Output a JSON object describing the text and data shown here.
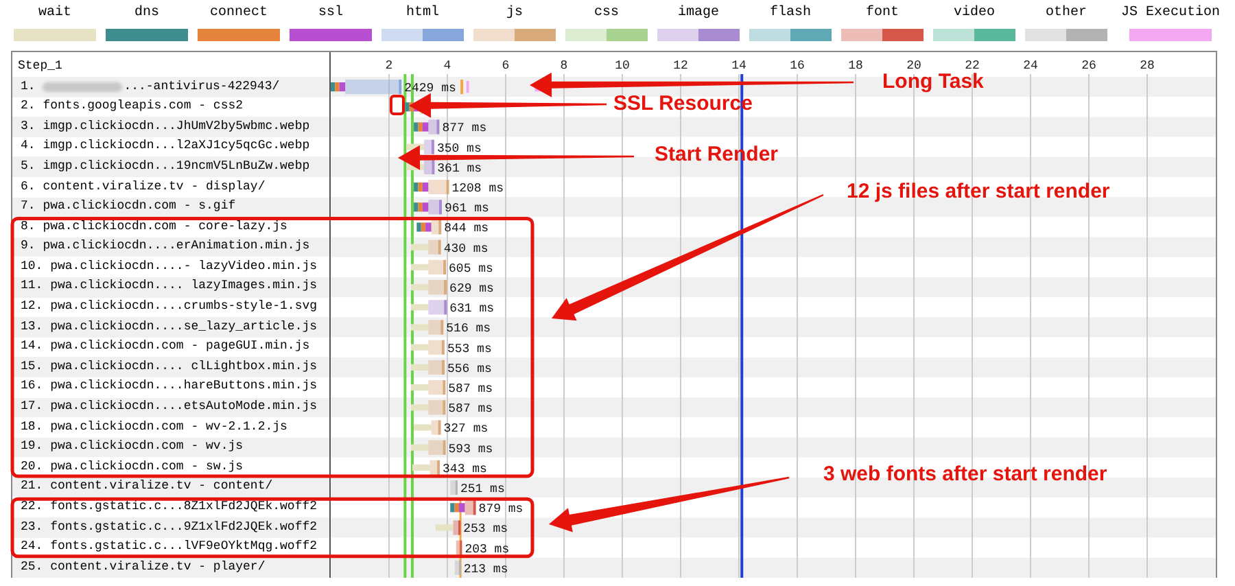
{
  "legend": [
    {
      "label": "wait",
      "kind": "phase",
      "color": "#e6e3c4"
    },
    {
      "label": "dns",
      "kind": "phase",
      "color": "#3f8c8f"
    },
    {
      "label": "connect",
      "kind": "phase",
      "color": "#e5843c"
    },
    {
      "label": "ssl",
      "kind": "phase",
      "color": "#b84fd1"
    },
    {
      "label": "html",
      "kind": "type",
      "color": "#86a6dc"
    },
    {
      "label": "js",
      "kind": "type",
      "color": "#d9ab7c"
    },
    {
      "label": "css",
      "kind": "type",
      "color": "#a7d28f"
    },
    {
      "label": "image",
      "kind": "type",
      "color": "#a98bd1"
    },
    {
      "label": "flash",
      "kind": "type",
      "color": "#5ea9b3"
    },
    {
      "label": "font",
      "kind": "type",
      "color": "#d5584b"
    },
    {
      "label": "video",
      "kind": "type",
      "color": "#5ab99d"
    },
    {
      "label": "other",
      "kind": "type",
      "color": "#b3b3b3"
    },
    {
      "label": "JS Execution",
      "kind": "phase",
      "color": "#f2a9f2"
    }
  ],
  "waterfall": {
    "step_label": "Step_1",
    "ticks": [
      "2",
      "4",
      "6",
      "8",
      "10",
      "12",
      "14",
      "16",
      "18",
      "20",
      "22",
      "24",
      "26",
      "28"
    ],
    "rows": [
      {
        "label": "1. ...-antivirus-422943/",
        "duration": "2429 ms",
        "kind": "html",
        "redacted": true,
        "new_connection": true,
        "queued": false
      },
      {
        "label": "2. fonts.googleapis.com - css2",
        "kind": "css",
        "redacted": false,
        "new_connection": true,
        "queued": false
      },
      {
        "label": "3. imgp.clickiocdn...JhUmV2by5wbmc.webp",
        "duration": "877 ms",
        "kind": "image",
        "redacted": false,
        "new_connection": true,
        "queued": false
      },
      {
        "label": "4. imgp.clickiocdn...l2aXJ1cy5qcGc.webp",
        "duration": "350 ms",
        "kind": "image",
        "redacted": false,
        "new_connection": false,
        "queued": true
      },
      {
        "label": "5. imgp.clickiocdn...19ncmV5LnBuZw.webp",
        "duration": "361 ms",
        "kind": "image",
        "redacted": false,
        "new_connection": false,
        "queued": true
      },
      {
        "label": "6. content.viralize.tv - display/",
        "duration": "1208 ms",
        "kind": "js",
        "redacted": false,
        "new_connection": true,
        "queued": false
      },
      {
        "label": "7. pwa.clickiocdn.com - s.gif",
        "duration": "961 ms",
        "kind": "image",
        "redacted": false,
        "new_connection": true,
        "queued": false
      },
      {
        "label": "8. pwa.clickiocdn.com - core-lazy.js",
        "duration": "844 ms",
        "kind": "js",
        "redacted": false,
        "new_connection": true,
        "queued": false
      },
      {
        "label": "9. pwa.clickiocdn....erAnimation.min.js",
        "duration": "430 ms",
        "kind": "js",
        "redacted": false,
        "new_connection": false,
        "queued": true
      },
      {
        "label": "10. pwa.clickiocdn....- lazyVideo.min.js",
        "duration": "605 ms",
        "kind": "js",
        "redacted": false,
        "new_connection": false,
        "queued": true
      },
      {
        "label": "11. pwa.clickiocdn.... lazyImages.min.js",
        "duration": "629 ms",
        "kind": "js",
        "redacted": false,
        "new_connection": false,
        "queued": true
      },
      {
        "label": "12. pwa.clickiocdn....crumbs-style-1.svg",
        "duration": "631 ms",
        "kind": "image",
        "redacted": false,
        "new_connection": false,
        "queued": true
      },
      {
        "label": "13. pwa.clickiocdn....se_lazy_article.js",
        "duration": "516 ms",
        "kind": "js",
        "redacted": false,
        "new_connection": false,
        "queued": true
      },
      {
        "label": "14. pwa.clickiocdn.com - pageGUI.min.js",
        "duration": "553 ms",
        "kind": "js",
        "redacted": false,
        "new_connection": false,
        "queued": true
      },
      {
        "label": "15. pwa.clickiocdn.... clLightbox.min.js",
        "duration": "556 ms",
        "kind": "js",
        "redacted": false,
        "new_connection": false,
        "queued": true
      },
      {
        "label": "16. pwa.clickiocdn....hareButtons.min.js",
        "duration": "587 ms",
        "kind": "js",
        "redacted": false,
        "new_connection": false,
        "queued": true
      },
      {
        "label": "17. pwa.clickiocdn....etsAutoMode.min.js",
        "duration": "587 ms",
        "kind": "js",
        "redacted": false,
        "new_connection": false,
        "queued": true
      },
      {
        "label": "18. pwa.clickiocdn.com - wv-2.1.2.js",
        "duration": "327 ms",
        "kind": "js",
        "redacted": false,
        "new_connection": false,
        "queued": true
      },
      {
        "label": "19. pwa.clickiocdn.com - wv.js",
        "duration": "593 ms",
        "kind": "js",
        "redacted": false,
        "new_connection": false,
        "queued": true
      },
      {
        "label": "20. pwa.clickiocdn.com - sw.js",
        "duration": "343 ms",
        "kind": "js",
        "redacted": false,
        "new_connection": false,
        "queued": true
      },
      {
        "label": "21. content.viralize.tv - content/",
        "duration": "251 ms",
        "kind": "other",
        "redacted": false,
        "new_connection": false,
        "queued": false
      },
      {
        "label": "22. fonts.gstatic.c...8Z1xlFd2JQEk.woff2",
        "duration": "879 ms",
        "kind": "font",
        "redacted": false,
        "new_connection": true,
        "queued": false
      },
      {
        "label": "23. fonts.gstatic.c...9Z1xlFd2JQEk.woff2",
        "duration": "253 ms",
        "kind": "font",
        "redacted": false,
        "new_connection": false,
        "queued": true
      },
      {
        "label": "24. fonts.gstatic.c...lVF9eOYktMqg.woff2",
        "duration": "203 ms",
        "kind": "font",
        "redacted": false,
        "new_connection": false,
        "queued": false
      },
      {
        "label": "25. content.viralize.tv - player/",
        "duration": "213 ms",
        "kind": "other",
        "redacted": false,
        "new_connection": false,
        "queued": false
      }
    ]
  },
  "callouts": [
    {
      "text": "Long Task"
    },
    {
      "text": "SSL Resource"
    },
    {
      "text": "Start Render"
    },
    {
      "text": "12 js files after start render"
    },
    {
      "text": "3 web fonts after start render"
    }
  ]
}
